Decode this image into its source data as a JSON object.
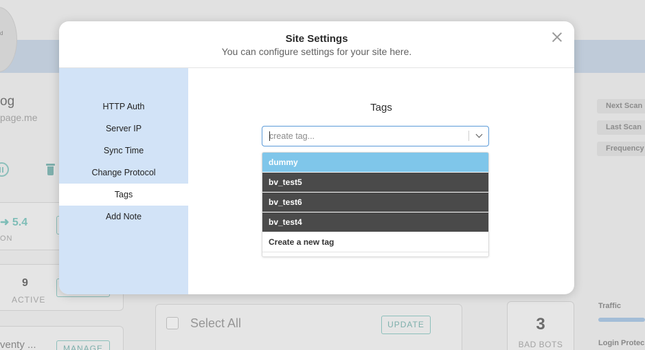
{
  "background": {
    "avatar_text": "d",
    "site_name": "og",
    "site_url": "page.me",
    "version": "5.4",
    "version_label": "ON",
    "active_count": "9",
    "active_label": "ACTIVE",
    "plugin_name": "venty ...",
    "manage_label": "MANAGE",
    "select_all_label": "Select All",
    "update_label": "UPDATE",
    "bad_bots_count": "3",
    "bad_bots_label": "BAD BOTS",
    "traffic_label": "Traffic",
    "login_label": "Login Protec",
    "chips": [
      "Next Scan",
      "Last Scan",
      "Frequency"
    ]
  },
  "modal": {
    "title": "Site Settings",
    "subtitle": "You can configure settings for your site here.",
    "sidebar": {
      "items": [
        {
          "label": "HTTP Auth"
        },
        {
          "label": "Server IP"
        },
        {
          "label": "Sync Time"
        },
        {
          "label": "Change Protocol"
        },
        {
          "label": "Tags",
          "active": true
        },
        {
          "label": "Add Note"
        }
      ]
    },
    "tags": {
      "heading": "Tags",
      "placeholder": "create tag...",
      "value": "",
      "options": [
        {
          "label": "dummy",
          "highlighted": true
        },
        {
          "label": "bv_test5"
        },
        {
          "label": "bv_test6"
        },
        {
          "label": "bv_test4"
        }
      ],
      "create_option": "Create a new tag"
    }
  },
  "colors": {
    "sidebar_bg": "#d2e3f7",
    "focus_border": "#5b9ad8",
    "highlight_option": "#7fc6ea",
    "dark_option": "#4a4a4a",
    "accent_teal": "#7fb7b3"
  }
}
